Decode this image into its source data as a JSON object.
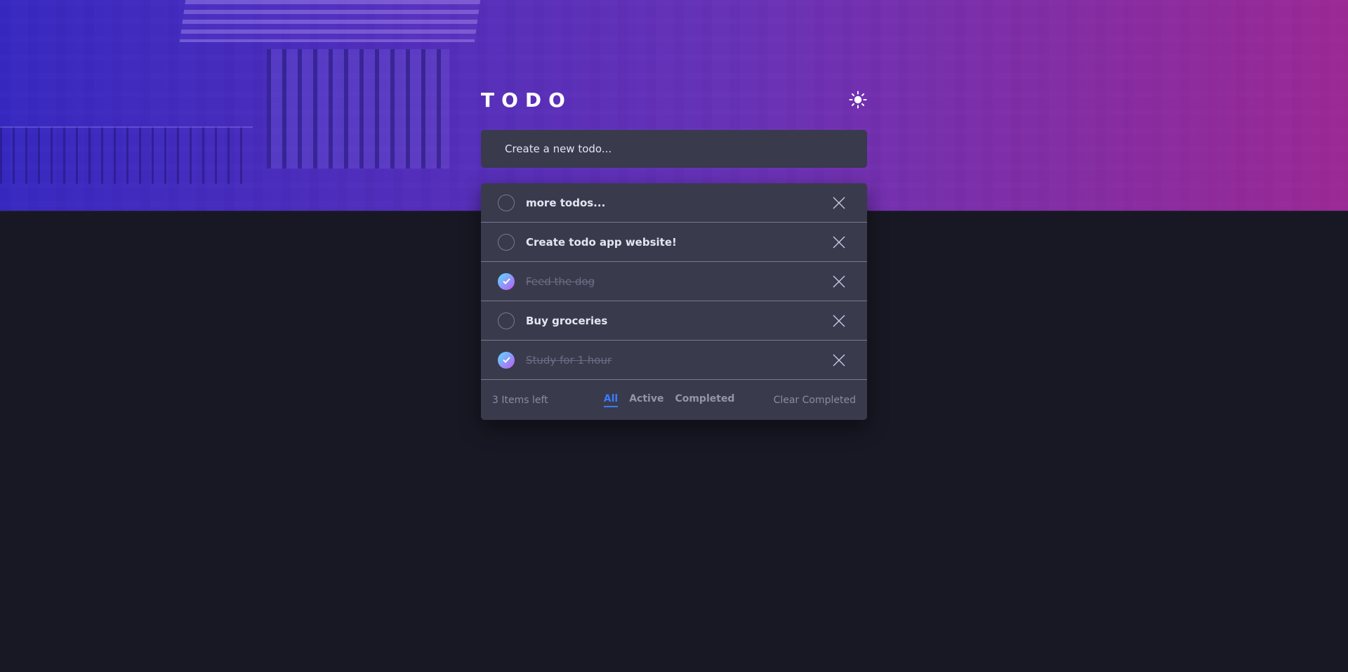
{
  "app": {
    "title": "TODO",
    "theme_icon": "sun-icon"
  },
  "new_todo": {
    "placeholder": "Create a new todo..."
  },
  "todos": [
    {
      "text": "more todos...",
      "completed": false
    },
    {
      "text": "Create todo app website!",
      "completed": false
    },
    {
      "text": "Feed the dog",
      "completed": true
    },
    {
      "text": "Buy groceries",
      "completed": false
    },
    {
      "text": "Study for 1 hour",
      "completed": true
    }
  ],
  "footer": {
    "items_left": "3 Items left",
    "filters": [
      "All",
      "Active",
      "Completed"
    ],
    "active_filter": "All",
    "clear_label": "Clear Completed"
  },
  "colors": {
    "accent": "#3a7cfd",
    "check_gradient_start": "#57ddff",
    "check_gradient_end": "#c058f3",
    "panel": "#393a4c",
    "background": "#181824"
  }
}
